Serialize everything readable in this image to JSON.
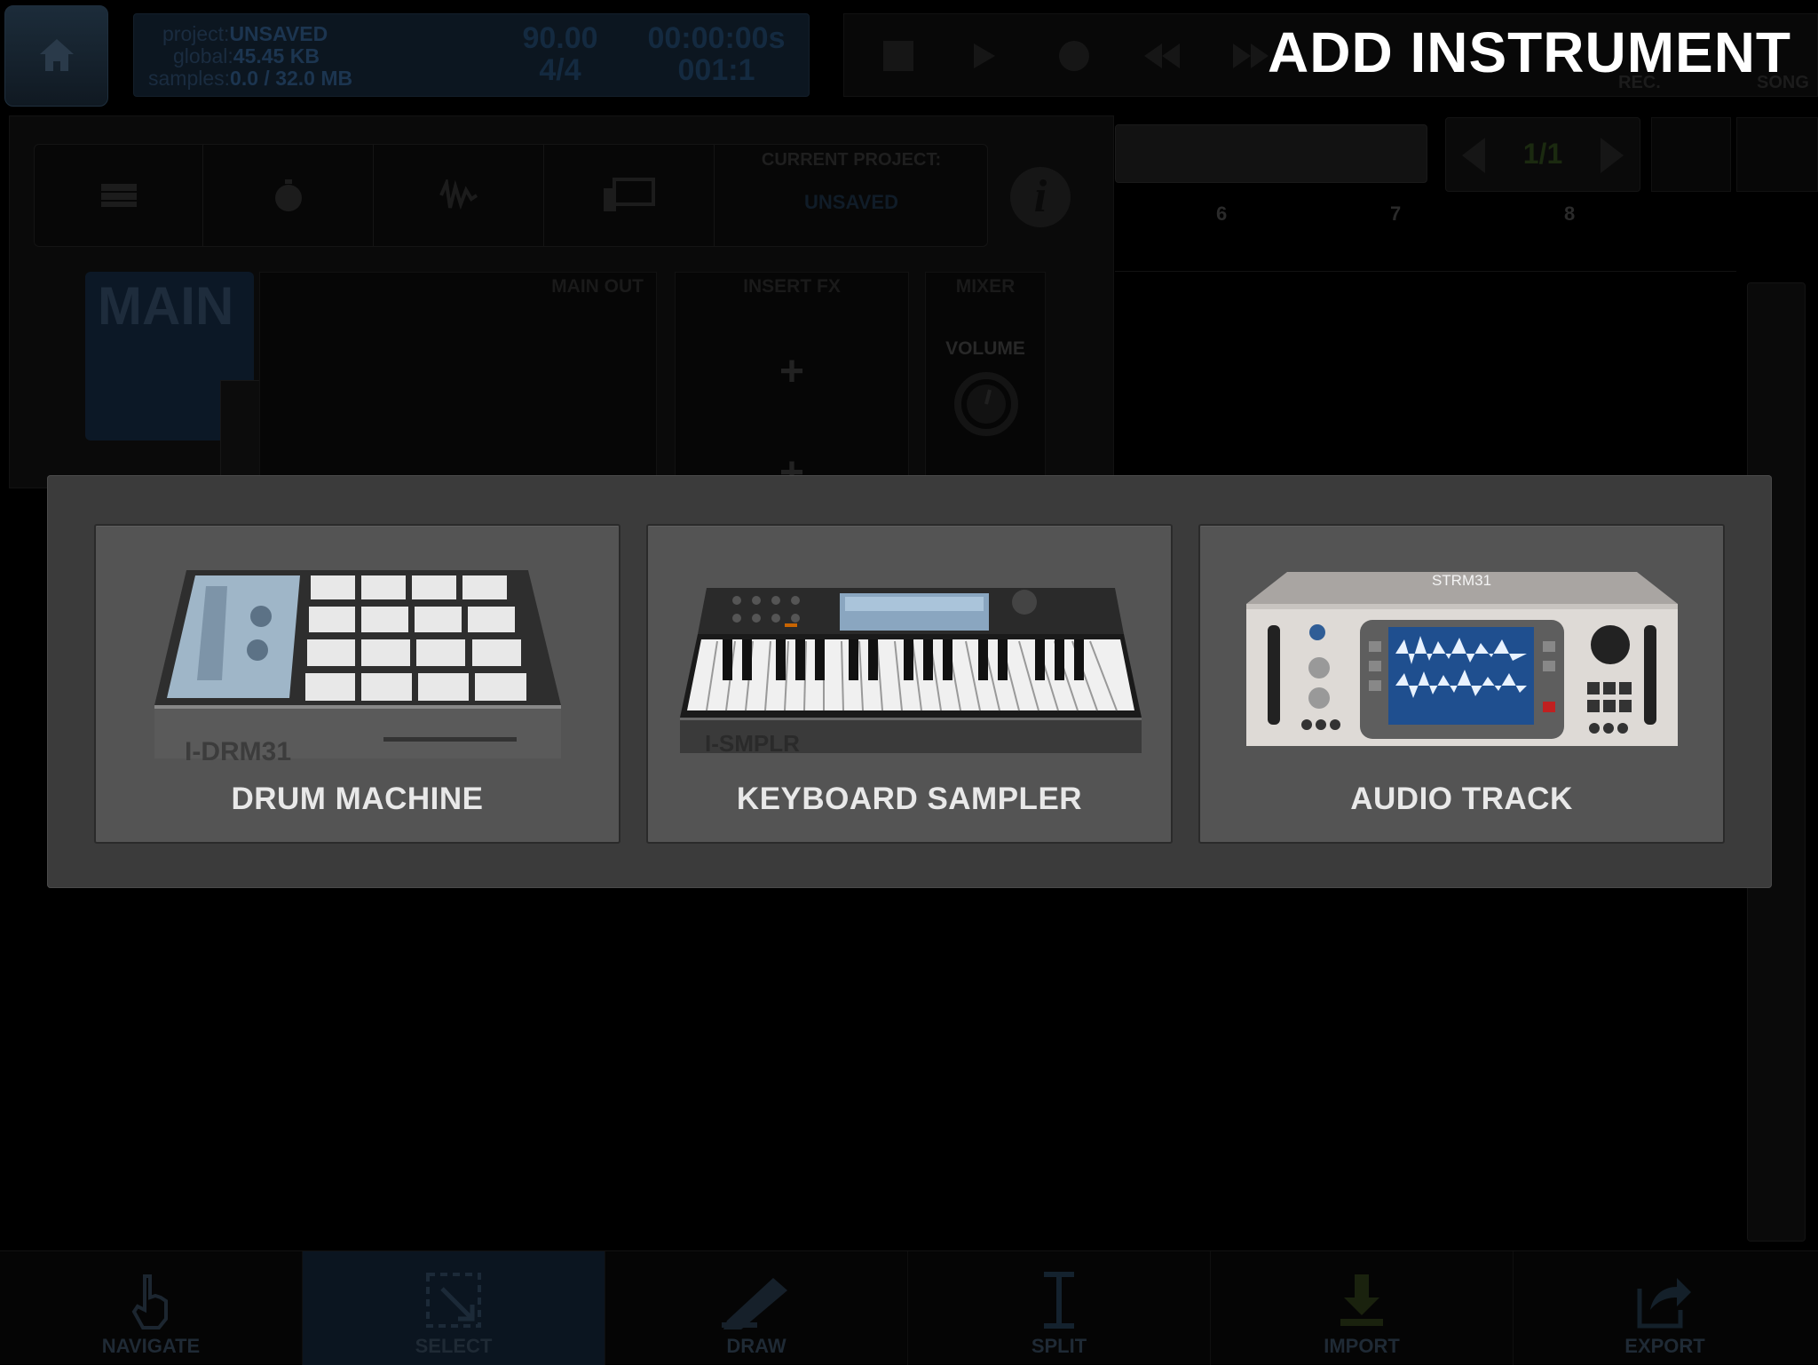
{
  "topbar": {
    "project_label": "project:",
    "project_value": "UNSAVED",
    "global_label": "global:",
    "global_value": "45.45 KB",
    "samples_label": "samples:",
    "samples_value": "0.0 / 32.0 MB",
    "tempo": "90.00",
    "signature": "4/4",
    "time": "00:00:00s",
    "position": "001:1",
    "rec_label": "REC.",
    "song_label": "SONG"
  },
  "title": "ADD INSTRUMENT",
  "background": {
    "current_project_label": "CURRENT PROJECT:",
    "current_project_value": "UNSAVED",
    "info_label": "i",
    "main_label": "MAIN",
    "main_out_label": "MAIN OUT",
    "insert_fx_label": "INSERT FX",
    "mixer_label": "MIXER",
    "volume_label": "VOLUME",
    "plus": "+",
    "page_indicator": "1/1",
    "ruler": [
      "6",
      "7",
      "8"
    ]
  },
  "instruments": [
    {
      "label": "DRUM MACHINE",
      "device_name": "I-DRM31",
      "icon": "drum-machine"
    },
    {
      "label": "KEYBOARD SAMPLER",
      "device_name": "I-SMPLR",
      "icon": "keyboard-sampler"
    },
    {
      "label": "AUDIO TRACK",
      "device_name": "STRM31",
      "icon": "audio-track"
    }
  ],
  "toolbar": [
    {
      "label": "NAVIGATE",
      "icon": "hand-icon"
    },
    {
      "label": "SELECT",
      "icon": "select-icon"
    },
    {
      "label": "DRAW",
      "icon": "pen-icon"
    },
    {
      "label": "SPLIT",
      "icon": "split-icon"
    },
    {
      "label": "IMPORT",
      "icon": "import-icon"
    },
    {
      "label": "EXPORT",
      "icon": "export-icon"
    }
  ],
  "colors": {
    "modal_bg": "#3b3b3b",
    "card_bg": "#545454",
    "card_label": "#e8e8e8"
  }
}
